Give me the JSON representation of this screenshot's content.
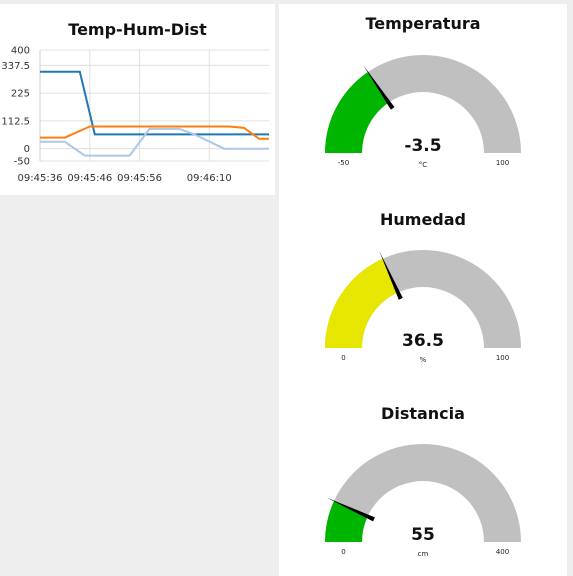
{
  "chart_card": {
    "title": "Temp-Hum-Dist"
  },
  "chart_data": {
    "type": "line",
    "title": "Temp-Hum-Dist",
    "xlabel": "",
    "ylabel": "",
    "y_ticks": [
      "400",
      "337.5",
      "225",
      "112.5",
      "0",
      "-50"
    ],
    "x_ticks": [
      "09:45:36",
      "09:45:46",
      "09:45:56",
      "09:46:10"
    ],
    "ylim": [
      -50,
      400
    ],
    "grid": true,
    "x_time_seconds": [
      0,
      5,
      8,
      9,
      18,
      23,
      27,
      29,
      32,
      37,
      40,
      42,
      46
    ],
    "series": [
      {
        "color": "#1f77b4",
        "points": [
          [
            0,
            312
          ],
          [
            8,
            312
          ],
          [
            11,
            58
          ],
          [
            20,
            58
          ],
          [
            35,
            58
          ],
          [
            46,
            58
          ]
        ]
      },
      {
        "color": "#ff7f0e",
        "points": [
          [
            0,
            45
          ],
          [
            5,
            45
          ],
          [
            10,
            90
          ],
          [
            20,
            90
          ],
          [
            28,
            90
          ],
          [
            38,
            90
          ],
          [
            41,
            84
          ],
          [
            44,
            40
          ],
          [
            46,
            40
          ]
        ]
      },
      {
        "color": "#aec7e8",
        "points": [
          [
            0,
            28
          ],
          [
            5,
            28
          ],
          [
            9,
            -28
          ],
          [
            18,
            -28
          ],
          [
            22,
            80
          ],
          [
            28,
            80
          ],
          [
            31,
            58
          ],
          [
            37,
            0
          ],
          [
            46,
            0
          ]
        ]
      }
    ]
  },
  "gauges": [
    {
      "title": "Temperatura",
      "value": "-3.5",
      "value_num": -3.5,
      "unit": "°C",
      "min": "-50",
      "max": "100",
      "min_num": -50,
      "max_num": 100,
      "fill_color": "#00b500"
    },
    {
      "title": "Humedad",
      "value": "36.5",
      "value_num": 36.5,
      "unit": "%",
      "min": "0",
      "max": "100",
      "min_num": 0,
      "max_num": 100,
      "fill_color": "#e6e600"
    },
    {
      "title": "Distancia",
      "value": "55",
      "value_num": 55,
      "unit": "cm",
      "min": "0",
      "max": "400",
      "min_num": 0,
      "max_num": 400,
      "fill_color": "#00b500"
    }
  ],
  "colors": {
    "gauge_track": "#c0c0c0",
    "needle": "#000000",
    "grid": "#e0e0e0"
  }
}
